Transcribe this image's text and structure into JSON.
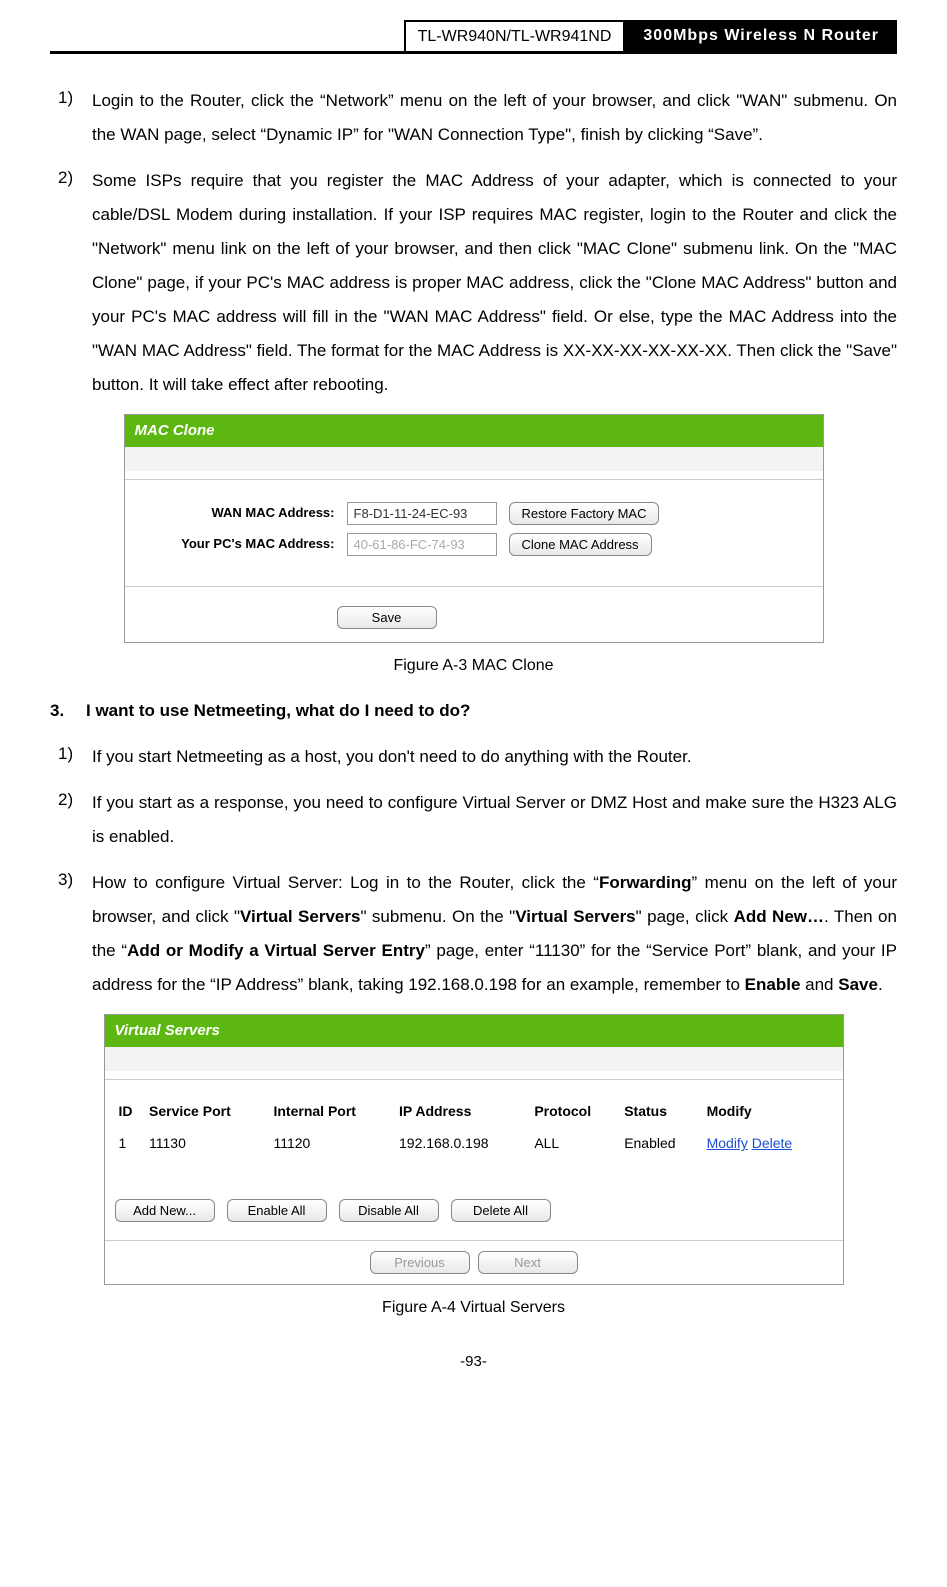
{
  "header": {
    "model": "TL-WR940N/TL-WR941ND",
    "title": "300Mbps Wireless N Router"
  },
  "items12": {
    "n1": "1)",
    "t1": "Login to the Router, click the “Network” menu on the left of your browser, and click \"WAN\" submenu. On the WAN page, select “Dynamic IP” for \"WAN Connection Type\", finish by clicking “Save”.",
    "n2": "2)",
    "t2": "Some ISPs require that you register the MAC Address of your adapter, which is connected to your cable/DSL Modem during installation. If your ISP requires MAC register, login to the Router and click the \"Network\" menu link on the left of your browser, and then click \"MAC Clone\" submenu link. On the \"MAC Clone\" page, if your PC's MAC address is proper MAC address, click the \"Clone MAC Address\" button and your PC's MAC address will fill in the \"WAN MAC Address\" field. Or else, type the MAC Address into the \"WAN MAC Address\" field. The format for the MAC Address is XX-XX-XX-XX-XX-XX. Then click the \"Save\" button. It will take effect after rebooting."
  },
  "mac_panel": {
    "title": "MAC Clone",
    "wan_label": "WAN MAC Address:",
    "wan_value": "F8-D1-11-24-EC-93",
    "restore_btn": "Restore Factory MAC",
    "pc_label": "Your PC's MAC Address:",
    "pc_value": "40-61-86-FC-74-93",
    "clone_btn": "Clone MAC Address",
    "save_btn": "Save"
  },
  "figA3": "Figure A-3 MAC Clone",
  "section3": {
    "num": "3.",
    "title": "I want to use Netmeeting, what do I need to do?"
  },
  "items3": {
    "n1": "1)",
    "t1": "If you start Netmeeting as a host, you don't need to do anything with the Router.",
    "n2": "2)",
    "t2": "If you start as a response, you need to configure Virtual Server or DMZ Host and make sure the H323 ALG is enabled.",
    "n3": "3)",
    "t3a": "How to configure Virtual Server: Log in to the Router, click the “",
    "t3b": "Forwarding",
    "t3c": "” menu on the left of your browser, and click \"",
    "t3d": "Virtual Servers",
    "t3e": "\" submenu. On the \"",
    "t3f": "Virtual Servers",
    "t3g": "\" page, click ",
    "t3h": "Add New…",
    "t3i": ". Then on the “",
    "t3j": "Add or Modify a Virtual Server Entry",
    "t3k": "” page, enter “11130” for the “Service Port” blank, and your IP address for the “IP Address” blank, taking 192.168.0.198 for an example, remember to ",
    "t3l": "Enable",
    "t3m": " and ",
    "t3n": "Save",
    "t3o": "."
  },
  "vs_panel": {
    "title": "Virtual Servers",
    "h_id": "ID",
    "h_sp": "Service Port",
    "h_ip_int": "Internal Port",
    "h_ip": "IP Address",
    "h_proto": "Protocol",
    "h_status": "Status",
    "h_modify": "Modify",
    "r1_id": "1",
    "r1_sp": "11130",
    "r1_int": "11120",
    "r1_ip": "192.168.0.198",
    "r1_proto": "ALL",
    "r1_status": "Enabled",
    "r1_modify": "Modify",
    "r1_delete": "Delete",
    "add_new": "Add New...",
    "enable_all": "Enable All",
    "disable_all": "Disable All",
    "delete_all": "Delete All",
    "prev": "Previous",
    "next": "Next"
  },
  "figA4": "Figure A-4 Virtual Servers",
  "page_num": "-93-"
}
